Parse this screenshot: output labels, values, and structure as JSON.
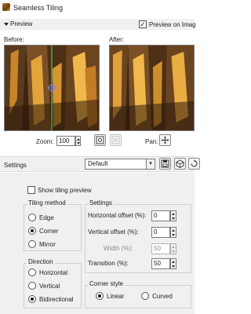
{
  "window": {
    "title": "Seamless Tiling"
  },
  "preview_bar": {
    "label": "Preview",
    "preview_on_image_label": "Preview on Imag",
    "preview_on_image_checked": true
  },
  "before": {
    "label": "Before:"
  },
  "after": {
    "label": "After:"
  },
  "zoom": {
    "label": "Zoom:",
    "value": "100"
  },
  "pan": {
    "label": "Pan:"
  },
  "settings_row": {
    "label": "Settings",
    "preset_value": "Default"
  },
  "show_tiling_preview": {
    "label": "Show tiling preview",
    "checked": false
  },
  "tiling_method": {
    "title": "Tiling method",
    "options": [
      "Edge",
      "Corner",
      "Mirror"
    ],
    "selected": "Corner"
  },
  "settings_group": {
    "title": "Settings",
    "horizontal_offset_label": "Horizontal offset (%):",
    "horizontal_offset_value": "0",
    "vertical_offset_label": "Vertical offset (%):",
    "vertical_offset_value": "0",
    "width_label": "Width (%):",
    "width_value": "50",
    "transition_label": "Transition (%):",
    "transition_value": "50"
  },
  "direction": {
    "title": "Direction",
    "options": [
      "Horizontal",
      "Vertical",
      "Bidirectional"
    ],
    "selected": "Bidirectional"
  },
  "corner_style": {
    "title": "Corner style",
    "options": [
      "Linear",
      "Curved"
    ],
    "selected": "Linear"
  },
  "icons": {
    "app": "seamless-tiling-app-icon",
    "collapse": "triangle-down-icon",
    "checkbox": "check-icon",
    "zoom_fit": "zoom-fit-icon",
    "zoom_actual": "zoom-actual-icon",
    "pan": "move-cross-icon",
    "save_preset": "save-icon",
    "preset_manage": "cube-icon",
    "reset": "reset-icon"
  },
  "colors": {
    "accent_orange": "#d98a1f",
    "image_dark": "#4a2e14",
    "window_bg": "#f0f0f0"
  }
}
